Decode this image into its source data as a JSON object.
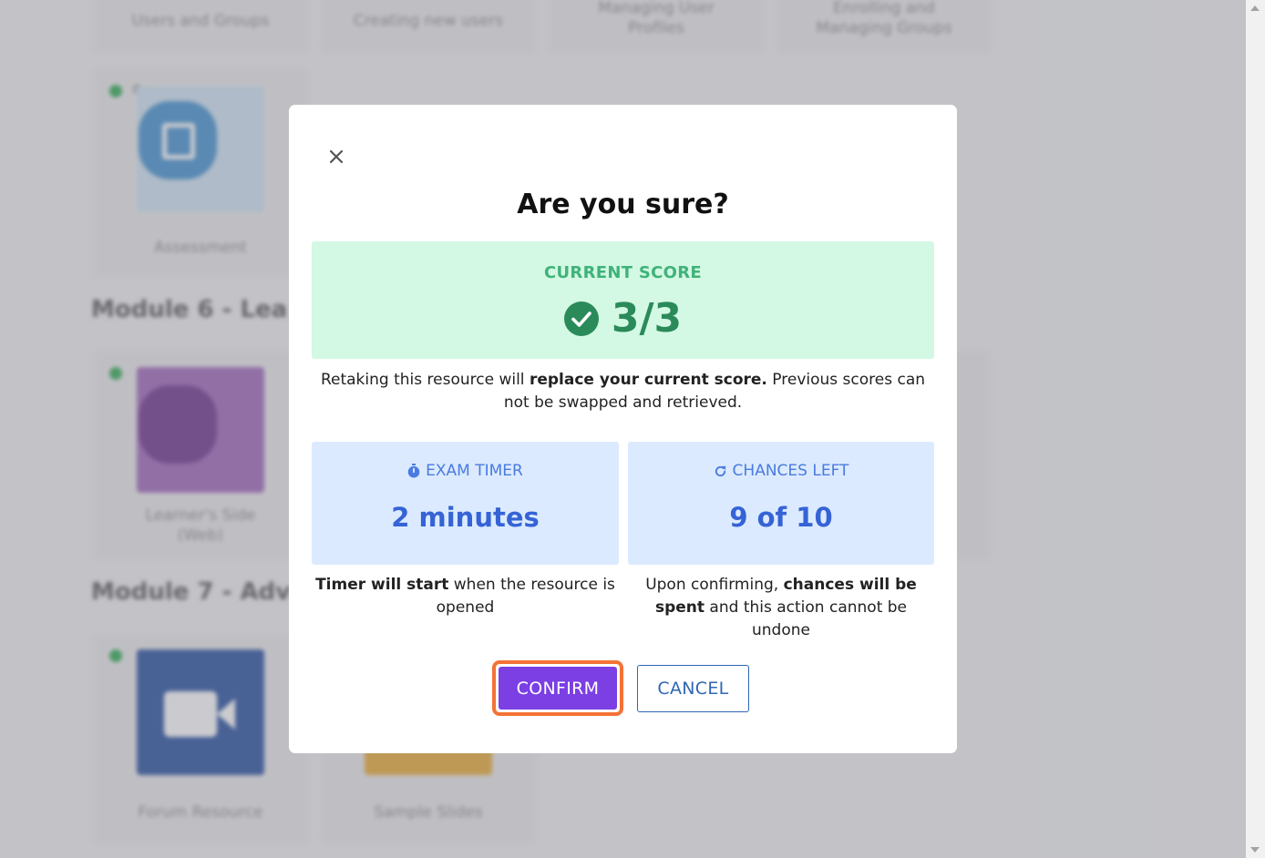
{
  "background": {
    "top_cards": [
      {
        "label": "Users and Groups"
      },
      {
        "label": "Creating new users"
      },
      {
        "label": "Managing User Profiles"
      },
      {
        "label": "Enrolling and Managing Groups"
      }
    ],
    "assessment_card": {
      "label": "Assessment"
    },
    "module6_title": "Module 6 - Lea",
    "module6_card": {
      "label": "Learner's Side (Web)"
    },
    "module7_title": "Module 7 - Adv",
    "module7_cards": [
      {
        "label": "Forum Resource"
      },
      {
        "label": "Sample Slides"
      }
    ]
  },
  "modal": {
    "title": "Are you sure?",
    "close_icon": "close-icon",
    "score": {
      "label": "CURRENT SCORE",
      "value": "3/3",
      "icon": "check-circle-icon"
    },
    "warning": {
      "part1": "Retaking this resource will ",
      "bold": "replace your current score.",
      "part2": " Previous scores can not be swapped and retrieved."
    },
    "timer": {
      "icon": "stopwatch-icon",
      "label": "EXAM TIMER",
      "value": "2 minutes",
      "note_bold": "Timer will start",
      "note_rest": " when the resource is opened"
    },
    "chances": {
      "icon": "refresh-icon",
      "label": "CHANCES LEFT",
      "value": "9 of 10",
      "note_part1": "Upon confirming, ",
      "note_bold": "chances will be spent",
      "note_rest": " and this action cannot be undone"
    },
    "confirm_label": "CONFIRM",
    "cancel_label": "CANCEL"
  },
  "colors": {
    "score_bg": "#d3f8e3",
    "score_text": "#2a8a5a",
    "info_bg": "#dbeafe",
    "info_value": "#3563d6",
    "confirm_bg": "#7b3fe4",
    "confirm_highlight": "#f47236",
    "cancel_border": "#2f66b3"
  }
}
